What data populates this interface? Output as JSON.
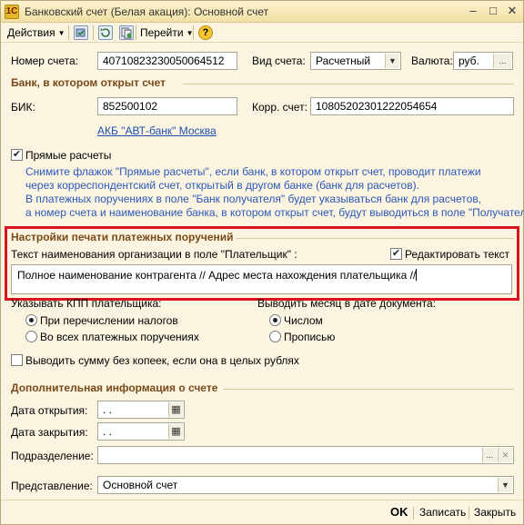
{
  "window": {
    "title": "Банковский счет (Белая акация): Основной счет",
    "minimize": "–",
    "maximize": "□",
    "close": "✕"
  },
  "toolbar": {
    "actions_label": "Действия",
    "goto_label": "Перейти",
    "help_icon": "?"
  },
  "account": {
    "number_label": "Номер счета:",
    "number_value": "40710823230050064512",
    "type_label": "Вид счета:",
    "type_value": "Расчетный",
    "currency_label": "Валюта:",
    "currency_value": "руб."
  },
  "bank_section": {
    "title": "Банк, в котором открыт счет",
    "bik_label": "БИК:",
    "bik_value": "852500102",
    "corr_label": "Корр. счет:",
    "corr_value": "10805202301222054654",
    "bank_link": "АКБ \"АВТ-банк\" Москва"
  },
  "direct": {
    "label": "Прямые расчеты",
    "checked": true,
    "hint_lines": [
      "Снимите флажок \"Прямые расчеты\", если банк, в котором открыт счет, проводит платежи",
      "через корреспондентский счет, открытый в другом банке (банк для расчетов).",
      "В платежных поручениях в поле \"Банк получателя\" будет указываться банк для расчетов,",
      "а номер счета и наименование банка, в котором открыт счет, будут выводиться в поле \"Получатель\"."
    ]
  },
  "print_section": {
    "title": "Настройки печати платежных поручений",
    "org_name_label": "Текст наименования организации в поле \"Плательщик\" :",
    "edit_text_label": "Редактировать текст",
    "edit_text_checked": true,
    "org_name_value": "Полное наименование контрагента // Адрес места нахождения плательщика //",
    "kpp_label": "Указывать КПП плательщика:",
    "kpp_options": [
      "При перечислении налогов",
      "Во всех платежных поручениях"
    ],
    "month_label": "Выводить месяц в дате документа:",
    "month_options": [
      "Числом",
      "Прописью"
    ],
    "no_kopecks_label": "Выводить сумму без копеек, если она в целых рублях",
    "no_kopecks_checked": false
  },
  "extra_section": {
    "title": "Дополнительная информация о счете",
    "open_date_label": "Дата открытия:",
    "open_date_value": " .  .",
    "close_date_label": "Дата закрытия:",
    "close_date_value": " .  .",
    "division_label": "Подразделение:",
    "division_value": "",
    "presentation_label": "Представление:",
    "presentation_value": "Основной счет"
  },
  "footer": {
    "ok_label": "OK",
    "save_label": "Записать",
    "close_label": "Закрыть"
  },
  "colors": {
    "highlight_border": "#d9141e",
    "section_title": "#7a4a1a",
    "hint_text": "#2b59b9",
    "link": "#1e4fb0"
  }
}
